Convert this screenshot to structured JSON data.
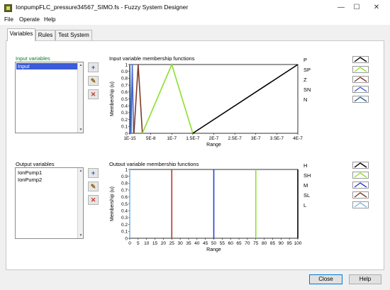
{
  "window": {
    "title": "IonpumpFLC_pressure34567_SIMO.fs - Fuzzy System Designer",
    "minimize_glyph": "—",
    "maximize_glyph": "☐",
    "close_glyph": "✕"
  },
  "menu": [
    "File",
    "Operate",
    "Help"
  ],
  "tabs": [
    {
      "label": "Variables",
      "active": true
    },
    {
      "label": "Rules",
      "active": false
    },
    {
      "label": "Test System",
      "active": false
    }
  ],
  "input_section": {
    "list_label": "Input variables",
    "items": [
      "Input"
    ],
    "selected_index": 0,
    "graph_title": "Input variable membership functions",
    "y_axis_label": "Membership (u)",
    "x_axis_label": "Range",
    "legend": [
      {
        "label": "P",
        "color": "#000000"
      },
      {
        "label": "SP",
        "color": "#8ce02c"
      },
      {
        "label": "Z",
        "color": "#7a3b28"
      },
      {
        "label": "SN",
        "color": "#4a63d8"
      },
      {
        "label": "N",
        "color": "#2f5f8f"
      }
    ]
  },
  "output_section": {
    "list_label": "Output variables",
    "items": [
      "IonPump1",
      "IonPump2"
    ],
    "graph_title": "Output variable membership functions",
    "y_axis_label": "Membership (u)",
    "x_axis_label": "Range",
    "legend": [
      {
        "label": "H",
        "color": "#000000"
      },
      {
        "label": "SH",
        "color": "#8ce02c"
      },
      {
        "label": "M",
        "color": "#2a3fd0"
      },
      {
        "label": "SL",
        "color": "#7a3b28"
      },
      {
        "label": "L",
        "color": "#7fb7e8"
      }
    ]
  },
  "side_buttons": {
    "add": "+",
    "edit": "✎",
    "delete": "✕"
  },
  "buttons": {
    "close": "Close",
    "help": "Help"
  },
  "chart_data": [
    {
      "type": "line",
      "title": "Input variable membership functions",
      "xlabel": "Range",
      "ylabel": "Membership (u)",
      "xlim": [
        1e-15,
        4e-07
      ],
      "ylim": [
        0,
        1
      ],
      "x_tick_labels": [
        "1E-15",
        "5E-8",
        "1E-7",
        "1.5E-7",
        "2E-7",
        "2.5E-7",
        "3E-7",
        "3.5E-7",
        "4E-7"
      ],
      "y_tick_labels": [
        "0",
        "0.1",
        "0.2",
        "0.3",
        "0.4",
        "0.5",
        "0.6",
        "0.7",
        "0.8",
        "0.9",
        "1"
      ],
      "series": [
        {
          "name": "P",
          "color": "#000000",
          "x": [
            1.5e-07,
            4e-07
          ],
          "y": [
            0,
            1
          ]
        },
        {
          "name": "SP",
          "color": "#8ce02c",
          "x": [
            3e-08,
            1e-07,
            1.5e-07
          ],
          "y": [
            0,
            1,
            0
          ]
        },
        {
          "name": "Z",
          "color": "#7a3b28",
          "x": [
            1e-08,
            2e-08,
            3e-08
          ],
          "y": [
            0,
            1,
            0
          ]
        },
        {
          "name": "SN",
          "color": "#4a63d8",
          "x": [
            3e-09,
            6e-09,
            9e-09
          ],
          "y": [
            0,
            1,
            0
          ]
        },
        {
          "name": "N",
          "color": "#2f5f8f",
          "x": [
            1e-15,
            1e-15,
            3e-09
          ],
          "y": [
            0,
            1,
            0
          ]
        }
      ]
    },
    {
      "type": "line",
      "title": "Output variable membership functions",
      "xlabel": "Range",
      "ylabel": "Membership (u)",
      "xlim": [
        0,
        100
      ],
      "ylim": [
        0,
        1
      ],
      "x_tick_labels": [
        "0",
        "5",
        "10",
        "15",
        "20",
        "25",
        "30",
        "35",
        "40",
        "45",
        "50",
        "55",
        "60",
        "65",
        "70",
        "75",
        "80",
        "85",
        "90",
        "95",
        "100"
      ],
      "y_tick_labels": [
        "0",
        "0.1",
        "0.2",
        "0.3",
        "0.4",
        "0.5",
        "0.6",
        "0.7",
        "0.8",
        "0.9",
        "1"
      ],
      "series": [
        {
          "name": "H",
          "color": "#000000",
          "x": [
            100,
            100
          ],
          "y": [
            0,
            1
          ]
        },
        {
          "name": "SH",
          "color": "#8ce02c",
          "x": [
            75,
            75
          ],
          "y": [
            0,
            1
          ]
        },
        {
          "name": "M",
          "color": "#2a3fd0",
          "x": [
            50,
            50
          ],
          "y": [
            0,
            1
          ]
        },
        {
          "name": "SL",
          "color": "#b03a2e",
          "x": [
            25,
            25
          ],
          "y": [
            0,
            1
          ]
        },
        {
          "name": "L",
          "color": "#7fb7e8",
          "x": [
            0,
            0
          ],
          "y": [
            0,
            1
          ]
        }
      ]
    }
  ]
}
